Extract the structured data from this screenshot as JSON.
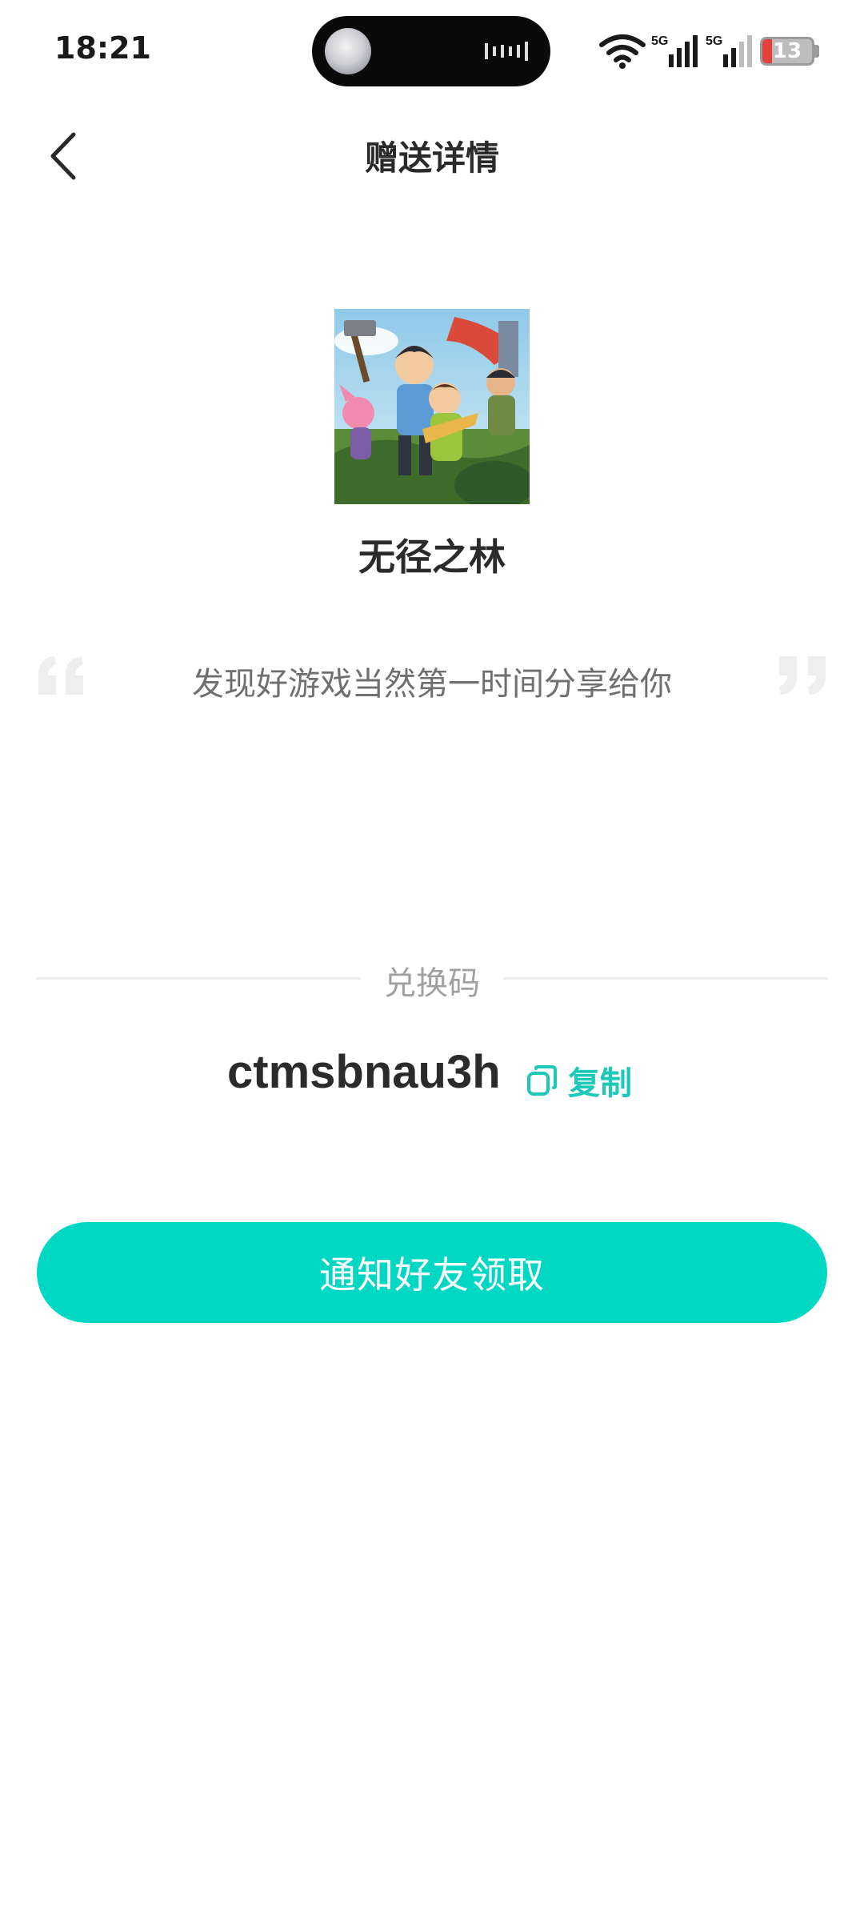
{
  "status_bar": {
    "time": "18:21",
    "battery_level": "13",
    "icons": [
      "wifi-icon",
      "signal-5g-icon",
      "signal-5g-icon",
      "battery-icon"
    ],
    "battery_low_color": "#e5413a"
  },
  "header": {
    "title": "赠送详情",
    "back_icon": "chevron-left-icon"
  },
  "game": {
    "name": "无径之林",
    "cover": "game-cover-illustration"
  },
  "message": {
    "text": "发现好游戏当然第一时间分享给你"
  },
  "redeem": {
    "label": "兑换码",
    "code": "ctmsbnau3h",
    "copy_label": "复制",
    "accent_color": "#1ec8b8"
  },
  "action": {
    "notify_label": "通知好友领取",
    "color": "#00d8c4"
  }
}
